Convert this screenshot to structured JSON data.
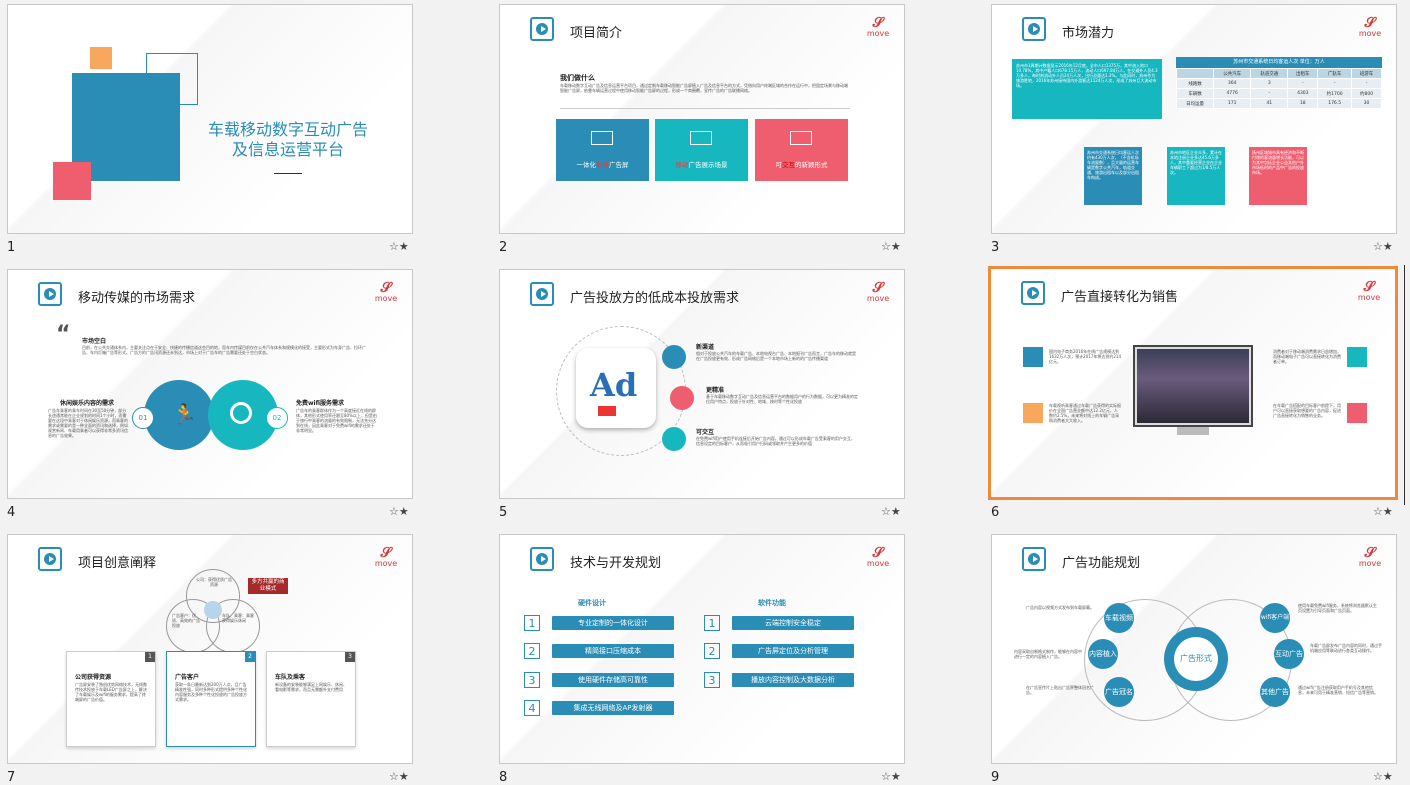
{
  "logo": {
    "mark": "𝒮",
    "text": "move"
  },
  "star": "☆★",
  "slides": [
    {
      "num": "1",
      "title_line1": "车载移动数字互动广告",
      "title_line2": "及信息运营平台"
    },
    {
      "num": "2",
      "title": "项目简介",
      "subtitle": "我们做什么",
      "body": "车载移动数字互动广告及信息运营平台项目，通过定制车载移动智能广告屏植入广告及信息平台的方式，凭借向用户终端区域的合作在运行中，把固定场景与移动端智能广告屏，依靠车辆运营过程中使用移动智能广告屏的过程，形成一个商圈覆，宣传广告的广告联播网络。",
      "cards": [
        {
          "label_a": "一体化",
          "label_hl": "智能",
          "label_b": "广告屏"
        },
        {
          "label_a": "",
          "label_hl": "移动",
          "label_b": "广告展示场景"
        },
        {
          "label_a": "可",
          "label_hl": "交互",
          "label_b": "的新颖形式"
        }
      ]
    },
    {
      "num": "3",
      "title": "市场潜力",
      "leftbox": "苏州市1周期计数据显示2016年12月底，全市人口1375万，其中流入地口10.78%，其中户籍人口678.15万人，流动人口697.84万人。在交通外人员4.3万多人，每时刻流动外人员24万人次，出行总量达1.3%。与此同时，苏州作为旅游胜地，2016年苏州接待国内外游客达1124万人次，形成了苏州巨大流动市场。",
      "table_title": "苏州市交通系统日均客运人次    单位：万人",
      "table_head": [
        "",
        "公共汽车",
        "轨道交通",
        "出租车",
        "广轨车",
        "班游车"
      ],
      "table_rows": [
        [
          "线路数",
          "364",
          "3",
          "-",
          "-",
          "-"
        ],
        [
          "车辆数",
          "4776",
          "-",
          "4303",
          "约1700",
          "约800"
        ],
        [
          "日均运量",
          "171",
          "41",
          "18",
          "176.5",
          "30"
        ]
      ],
      "notes": [
        "苏州市交通系统日均客运人次约有430万人次，（不含机场车流量数），且大量的运营车辆是数字公共汽车，轨道交通、旅游出租车以及部分出租车构成。",
        "苏州市地区企业众多，累计在本地注册企业多达45.6万多人，其中重要经营企业在企业车辆职工下超过为1/8.5万人次。",
        "扬州区域城市具有经济和不断付增的客流量增长功能，可以为其中包括企业公益其他户外市场低时的产品中广告的投放市场。"
      ]
    },
    {
      "num": "4",
      "title": "移动传媒的市场需求",
      "quote_title": "市场空白",
      "quote_body": "目前，在公共交通体系内，主要关注点在于安全、快捷的传播信道这些目的地，而车内传媒目前仅在公共汽车体系和规模化的接受，主要形式为车身广告、拉环广告、车内灯箱广告等形式。广告方的广告讯资源还未到达，市场上对于广告车的广告需要还处于空白状态。",
      "left_title": "休闲娱乐内容的需求",
      "left_body": "广告车乘客的乘车时间在30至50分钟，部分长途通常能在企业规划的时间1个小时，而需要在这段中乘客对于休闲娱乐资源，而乘客的需求或需要的是一种全面的资讯和选择，例如观赏新闻、车载用乘者可以获得非常多资讯信息的广告效果。",
      "right_title": "免费wifi服务需求",
      "right_body": "广告车的乘客群体作为一个高度接近在线的群体，其他形式使用率还跟至80%以上，但是由于旅行中乘客的流量的有效限制，无法充分达到在线，因此乘客对于免费wifi的需求还处于非常明显。",
      "n1": "01",
      "n2": "02"
    },
    {
      "num": "5",
      "title": "广告投放方的低成本投放需求",
      "ad": "Ad",
      "items": [
        {
          "title": "新渠道",
          "body": "相对于投放公共汽车的车载广告、本地电视台广告、本地报刊广告而言，广告车的移动就是在广告投放更有效、形成广告网络后是一个本地市场上新的的广告传播渠道"
        },
        {
          "title": "更精准",
          "body": "基于车载移动数字互动广告及信息运营平台的数据用户的行为数据，可以更为精准的定位用户特点，投放于针对性、地域、按时等个性化投放"
        },
        {
          "title": "可交互",
          "body": "在免费wifi用户使用手机连接后开始广告内容。通过可以形成车载广告受乘客的用户交互，信息设定的目标客户，从而吸引用户扫码或领取并产生更多的价值"
        }
      ]
    },
    {
      "num": "6",
      "title": "广告直接转化为销售",
      "tl": "国内电子商务2016年在线广告规模达到1632万人次，预计2017年将达到约214亿元。",
      "bl": "车载视听乘客通过车载广告获得的实际报价在全国广告营业额中达12.2亿元，人数约2.5%，未来将对线上的车辆广告采购消费者大大收入。",
      "tr": "消费者对于移动端消费需求日益增加，而移动端电子广告可以直接转化为消费者订单。",
      "br": "在车载广告搭配的目标客户前提下，用户可以直接获取想要的广告内容，促进广告直接转化为销售的业务。"
    },
    {
      "num": "7",
      "title": "项目创意阐释",
      "venn_a": "公司：获得优质广告资源",
      "venn_b": "广告客户：优质、高效的广告投放",
      "venn_c": "车队、乘客：乘客获得娱乐休闲",
      "tag": "多方共赢的商业模式",
      "cards": [
        {
          "n": "1",
          "title": "公司获得资源",
          "body": "广告屏安装了独创优势网络技术，无线数传技术投放于车载LED广告屏之上，解决了车载娱乐及wifi的服务需求，提高了终端屏的广告价值。"
        },
        {
          "n": "2",
          "title": "广告客户",
          "body": "获取一条日最新达到200万人次，且广告精准性强，同时多种形式提供多种个性化内容服务及多种个性化投放的广告投放方式需求。"
        },
        {
          "n": "3",
          "title": "车队及乘客",
          "body": "新设备的安装能够满足上网娱乐、休闲、看电影等需求，而且无需额外支付费用"
        }
      ]
    },
    {
      "num": "8",
      "title": "技术与开发规划",
      "left_head": "硬件设计",
      "right_head": "软件功能",
      "left": [
        {
          "n": "1",
          "t": "专业定制的一体化设计"
        },
        {
          "n": "2",
          "t": "精简接口压缩成本"
        },
        {
          "n": "3",
          "t": "使用硬件存储高可靠性"
        },
        {
          "n": "4",
          "t": "集成无线网络及AP发射器"
        }
      ],
      "right": [
        {
          "n": "1",
          "t": "云端控制安全稳定"
        },
        {
          "n": "2",
          "t": "广告屏定位及分析管理"
        },
        {
          "n": "3",
          "t": "播放内容控制及大数据分析"
        }
      ]
    },
    {
      "num": "9",
      "title": "广告功能规划",
      "center": "广告形式",
      "nodes": [
        "车载视频",
        "内容植入",
        "广告冠名",
        "wifi客户端",
        "互动广告",
        "其他广告"
      ],
      "texts": [
        "广告内容以视频方式发布到车载屏幕。",
        "内容采取自制格式制作，能够在内容中进行一定的内容植入广告。",
        "在广告宣传片上贴出广告界整体冠名广告。",
        "使用车载免费wifi服务，系统将浏览器默认主页设置为引导页面和广告页面。",
        "车载广告屏发布广告内容的同时，通过手机端应用等联动进行各类互动操作。",
        "通过wifi广告注册获取用户手机号及其他信息，未来可用于精准营销、短信广告等营销。"
      ]
    }
  ]
}
